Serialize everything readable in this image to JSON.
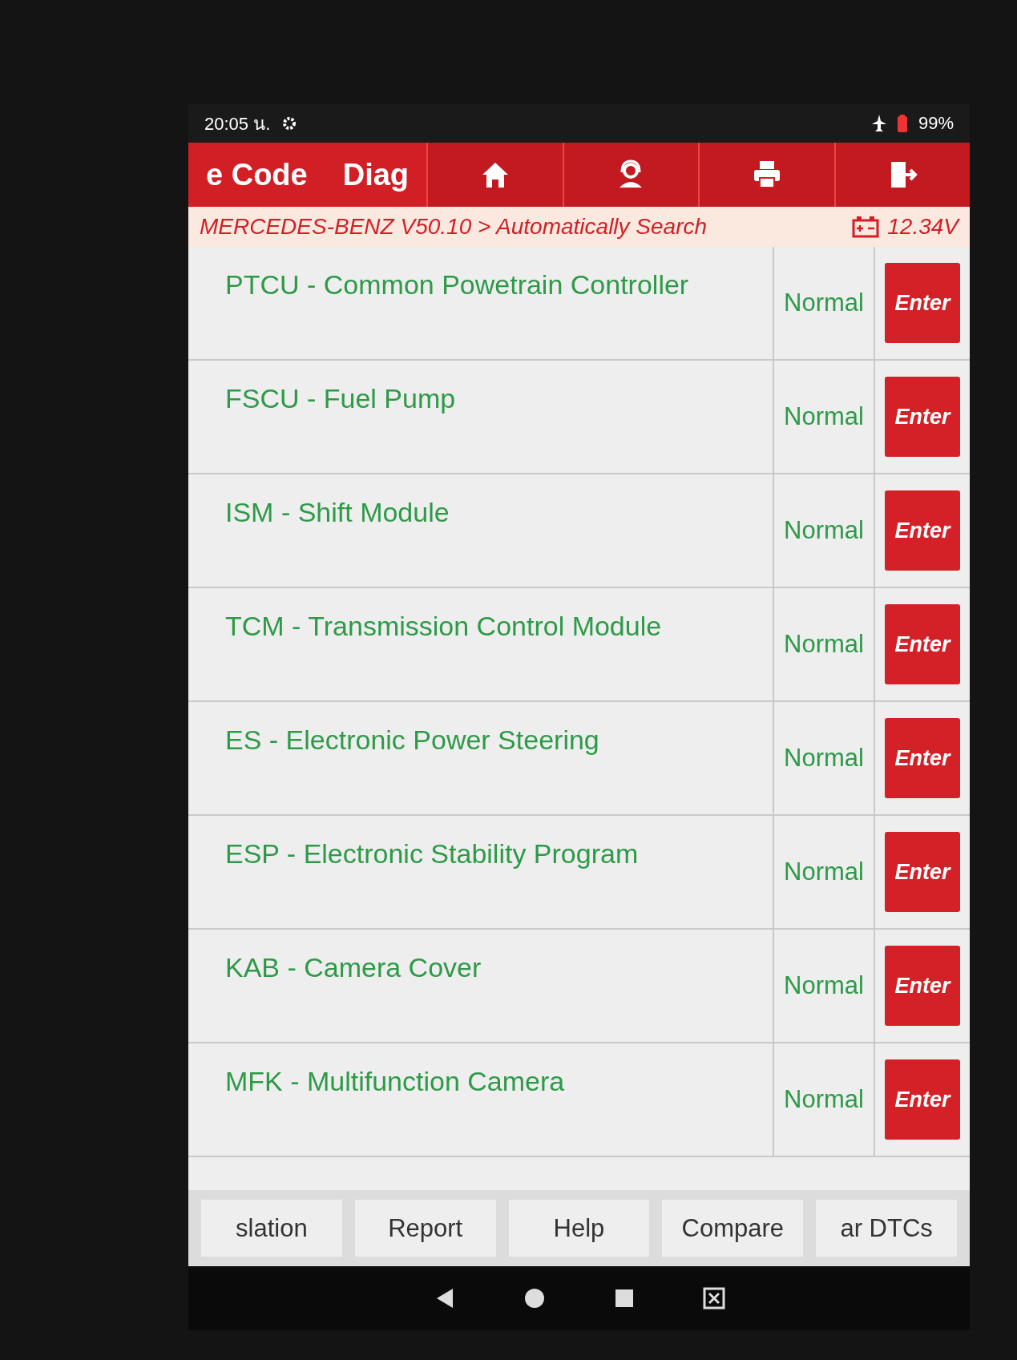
{
  "status_bar": {
    "time": "20:05 น.",
    "battery": "99%"
  },
  "header": {
    "tabs": [
      {
        "label": "e Code"
      },
      {
        "label": "Diag"
      }
    ],
    "icon_buttons": [
      {
        "kind": "home"
      },
      {
        "kind": "support"
      },
      {
        "kind": "print"
      },
      {
        "kind": "exit"
      }
    ]
  },
  "breadcrumb": {
    "path": "MERCEDES-BENZ V50.10 > Automatically Search",
    "voltage": "12.34V"
  },
  "modules": [
    {
      "name": "PTCU - Common Powetrain Controller",
      "status": "Normal",
      "action": "Enter"
    },
    {
      "name": "FSCU - Fuel Pump",
      "status": "Normal",
      "action": "Enter"
    },
    {
      "name": "ISM - Shift Module",
      "status": "Normal",
      "action": "Enter"
    },
    {
      "name": "TCM - Transmission Control Module",
      "status": "Normal",
      "action": "Enter"
    },
    {
      "name": "ES - Electronic Power Steering",
      "status": "Normal",
      "action": "Enter"
    },
    {
      "name": "ESP - Electronic Stability Program",
      "status": "Normal",
      "action": "Enter"
    },
    {
      "name": "KAB - Camera Cover",
      "status": "Normal",
      "action": "Enter"
    },
    {
      "name": "MFK - Multifunction Camera",
      "status": "Normal",
      "action": "Enter"
    }
  ],
  "bottom_buttons": [
    "slation",
    "Report",
    "Help",
    "Compare",
    "ar DTCs"
  ]
}
